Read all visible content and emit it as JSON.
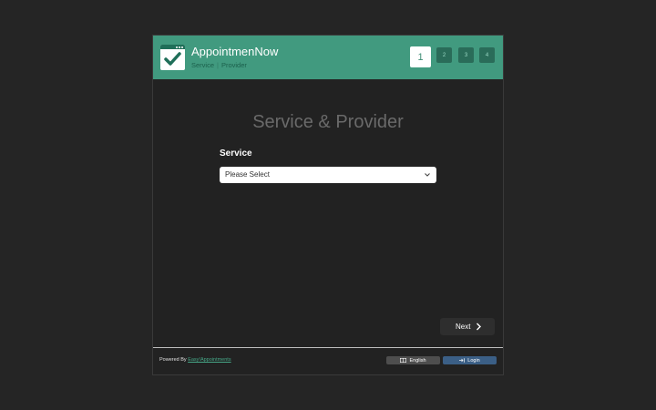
{
  "header": {
    "brand_title": "AppointmenNow",
    "breadcrumb": [
      "Service",
      "Provider"
    ],
    "breadcrumb_separator": "|",
    "steps": [
      "1",
      "2",
      "3",
      "4"
    ],
    "active_step": 1,
    "colors": {
      "header_bg": "#419a7f",
      "step_bg": "#2a6c59"
    }
  },
  "main": {
    "title": "Service & Provider",
    "service_label": "Service",
    "service_select": {
      "value": "Please Select"
    },
    "next_label": "Next"
  },
  "footer": {
    "powered_prefix": "Powered By",
    "powered_link": "Easy!Appointments",
    "language_label": "English",
    "login_label": "Login",
    "colors": {
      "login_bg": "#3b5f86",
      "language_bg": "#4e4e4e"
    }
  }
}
